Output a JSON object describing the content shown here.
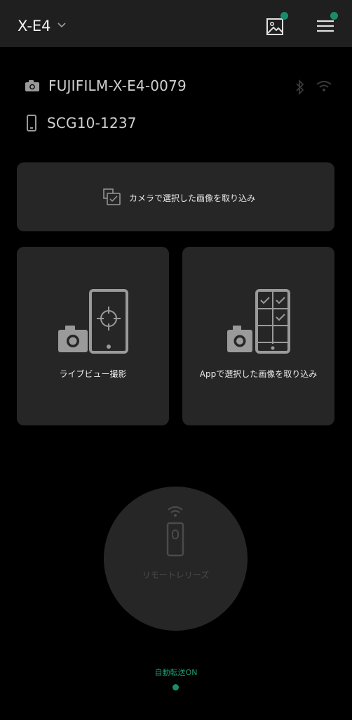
{
  "header": {
    "title": "X-E4",
    "gallery_icon": "gallery-icon",
    "menu_icon": "menu-icon",
    "accent": "#1a8c6c"
  },
  "devices": {
    "camera_name": "FUJIFILM-X-E4-0079",
    "phone_name": "SCG10-1237"
  },
  "actions": {
    "import_camera_selected": "カメラで選択した画像を取り込み",
    "live_view": "ライブビュー撮影",
    "import_app_selected": "Appで選択した画像を取り込み",
    "remote_release": "リモートレリーズ"
  },
  "auto_transfer": {
    "status": "自動転送ON"
  }
}
